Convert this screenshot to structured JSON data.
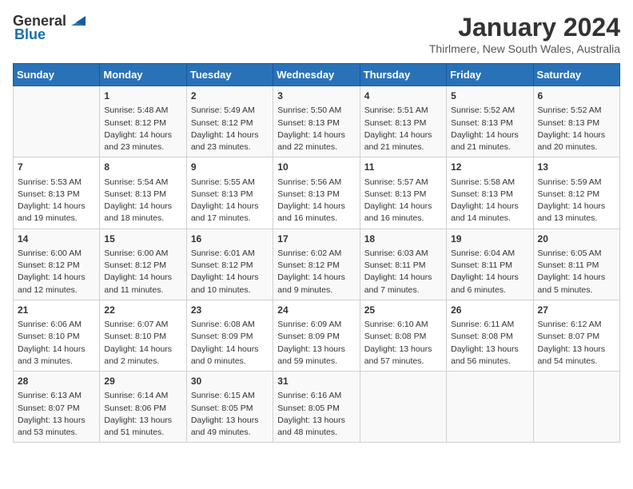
{
  "header": {
    "logo_general": "General",
    "logo_blue": "Blue",
    "month_year": "January 2024",
    "location": "Thirlmere, New South Wales, Australia"
  },
  "days_of_week": [
    "Sunday",
    "Monday",
    "Tuesday",
    "Wednesday",
    "Thursday",
    "Friday",
    "Saturday"
  ],
  "weeks": [
    [
      {
        "day": "",
        "content": ""
      },
      {
        "day": "1",
        "content": "Sunrise: 5:48 AM\nSunset: 8:12 PM\nDaylight: 14 hours\nand 23 minutes."
      },
      {
        "day": "2",
        "content": "Sunrise: 5:49 AM\nSunset: 8:12 PM\nDaylight: 14 hours\nand 23 minutes."
      },
      {
        "day": "3",
        "content": "Sunrise: 5:50 AM\nSunset: 8:13 PM\nDaylight: 14 hours\nand 22 minutes."
      },
      {
        "day": "4",
        "content": "Sunrise: 5:51 AM\nSunset: 8:13 PM\nDaylight: 14 hours\nand 21 minutes."
      },
      {
        "day": "5",
        "content": "Sunrise: 5:52 AM\nSunset: 8:13 PM\nDaylight: 14 hours\nand 21 minutes."
      },
      {
        "day": "6",
        "content": "Sunrise: 5:52 AM\nSunset: 8:13 PM\nDaylight: 14 hours\nand 20 minutes."
      }
    ],
    [
      {
        "day": "7",
        "content": "Sunrise: 5:53 AM\nSunset: 8:13 PM\nDaylight: 14 hours\nand 19 minutes."
      },
      {
        "day": "8",
        "content": "Sunrise: 5:54 AM\nSunset: 8:13 PM\nDaylight: 14 hours\nand 18 minutes."
      },
      {
        "day": "9",
        "content": "Sunrise: 5:55 AM\nSunset: 8:13 PM\nDaylight: 14 hours\nand 17 minutes."
      },
      {
        "day": "10",
        "content": "Sunrise: 5:56 AM\nSunset: 8:13 PM\nDaylight: 14 hours\nand 16 minutes."
      },
      {
        "day": "11",
        "content": "Sunrise: 5:57 AM\nSunset: 8:13 PM\nDaylight: 14 hours\nand 16 minutes."
      },
      {
        "day": "12",
        "content": "Sunrise: 5:58 AM\nSunset: 8:13 PM\nDaylight: 14 hours\nand 14 minutes."
      },
      {
        "day": "13",
        "content": "Sunrise: 5:59 AM\nSunset: 8:12 PM\nDaylight: 14 hours\nand 13 minutes."
      }
    ],
    [
      {
        "day": "14",
        "content": "Sunrise: 6:00 AM\nSunset: 8:12 PM\nDaylight: 14 hours\nand 12 minutes."
      },
      {
        "day": "15",
        "content": "Sunrise: 6:00 AM\nSunset: 8:12 PM\nDaylight: 14 hours\nand 11 minutes."
      },
      {
        "day": "16",
        "content": "Sunrise: 6:01 AM\nSunset: 8:12 PM\nDaylight: 14 hours\nand 10 minutes."
      },
      {
        "day": "17",
        "content": "Sunrise: 6:02 AM\nSunset: 8:12 PM\nDaylight: 14 hours\nand 9 minutes."
      },
      {
        "day": "18",
        "content": "Sunrise: 6:03 AM\nSunset: 8:11 PM\nDaylight: 14 hours\nand 7 minutes."
      },
      {
        "day": "19",
        "content": "Sunrise: 6:04 AM\nSunset: 8:11 PM\nDaylight: 14 hours\nand 6 minutes."
      },
      {
        "day": "20",
        "content": "Sunrise: 6:05 AM\nSunset: 8:11 PM\nDaylight: 14 hours\nand 5 minutes."
      }
    ],
    [
      {
        "day": "21",
        "content": "Sunrise: 6:06 AM\nSunset: 8:10 PM\nDaylight: 14 hours\nand 3 minutes."
      },
      {
        "day": "22",
        "content": "Sunrise: 6:07 AM\nSunset: 8:10 PM\nDaylight: 14 hours\nand 2 minutes."
      },
      {
        "day": "23",
        "content": "Sunrise: 6:08 AM\nSunset: 8:09 PM\nDaylight: 14 hours\nand 0 minutes."
      },
      {
        "day": "24",
        "content": "Sunrise: 6:09 AM\nSunset: 8:09 PM\nDaylight: 13 hours\nand 59 minutes."
      },
      {
        "day": "25",
        "content": "Sunrise: 6:10 AM\nSunset: 8:08 PM\nDaylight: 13 hours\nand 57 minutes."
      },
      {
        "day": "26",
        "content": "Sunrise: 6:11 AM\nSunset: 8:08 PM\nDaylight: 13 hours\nand 56 minutes."
      },
      {
        "day": "27",
        "content": "Sunrise: 6:12 AM\nSunset: 8:07 PM\nDaylight: 13 hours\nand 54 minutes."
      }
    ],
    [
      {
        "day": "28",
        "content": "Sunrise: 6:13 AM\nSunset: 8:07 PM\nDaylight: 13 hours\nand 53 minutes."
      },
      {
        "day": "29",
        "content": "Sunrise: 6:14 AM\nSunset: 8:06 PM\nDaylight: 13 hours\nand 51 minutes."
      },
      {
        "day": "30",
        "content": "Sunrise: 6:15 AM\nSunset: 8:05 PM\nDaylight: 13 hours\nand 49 minutes."
      },
      {
        "day": "31",
        "content": "Sunrise: 6:16 AM\nSunset: 8:05 PM\nDaylight: 13 hours\nand 48 minutes."
      },
      {
        "day": "",
        "content": ""
      },
      {
        "day": "",
        "content": ""
      },
      {
        "day": "",
        "content": ""
      }
    ]
  ]
}
